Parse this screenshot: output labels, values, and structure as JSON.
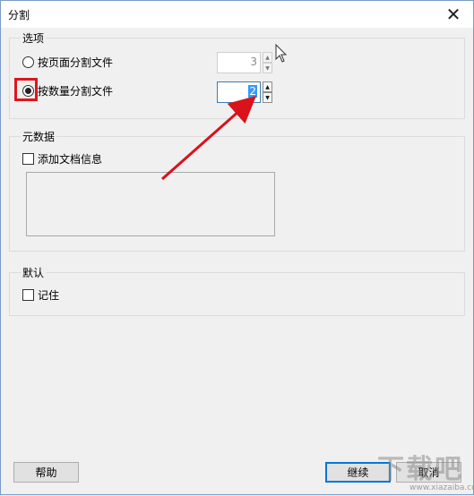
{
  "window": {
    "title": "分割",
    "close_glyph": "✕"
  },
  "options": {
    "legend": "选项",
    "by_pages_label": "按页面分割文件",
    "by_pages_value": "3",
    "by_count_label": "按数量分割文件",
    "by_count_value": "2"
  },
  "metadata": {
    "legend": "元数据",
    "add_doc_info_label": "添加文档信息"
  },
  "defaults": {
    "legend": "默认",
    "remember_label": "记住"
  },
  "buttons": {
    "help": "帮助",
    "continue": "继续",
    "cancel": "取消"
  },
  "watermark": {
    "text": "下载吧",
    "url": "www.xiazaiba.com"
  },
  "colors": {
    "highlight": "#e0161b",
    "selection": "#3399ff",
    "focus": "#0078d7"
  }
}
